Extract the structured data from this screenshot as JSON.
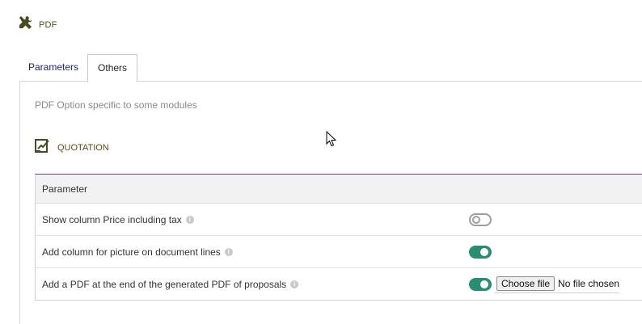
{
  "header": {
    "icon": "wrench-screwdriver-icon",
    "title": "PDF"
  },
  "tabs": [
    {
      "label": "Parameters",
      "active": false
    },
    {
      "label": "Others",
      "active": true
    }
  ],
  "panel": {
    "subtitle": "PDF Option specific to some modules",
    "section": {
      "icon": "quotation-icon",
      "label": "QUOTATION"
    },
    "table": {
      "header": "Parameter",
      "rows": [
        {
          "label": "Show column Price including tax",
          "control": "toggle",
          "state": "off"
        },
        {
          "label": "Add column for picture on document lines",
          "control": "toggle",
          "state": "on"
        },
        {
          "label": "Add a PDF at the end of the generated PDF of proposals",
          "control": "toggle+file",
          "state": "on",
          "file_button": "Choose file",
          "file_status": "No file chosen"
        }
      ]
    }
  },
  "colors": {
    "accent_toggle": "#2a8d72",
    "header_text": "#5b4a14",
    "tab_text": "#1a237e",
    "table_border_top": "#6b3a7c"
  }
}
